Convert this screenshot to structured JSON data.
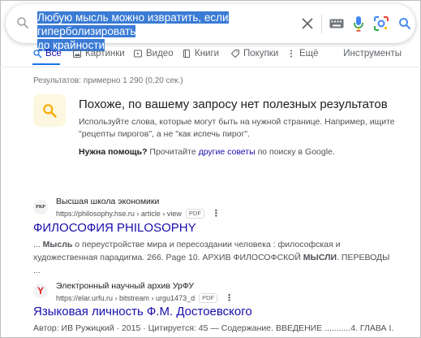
{
  "search": {
    "query_line1": "Любую мысль можно извратить, если гиперболизировать",
    "query_line2": "до крайности"
  },
  "tabs": [
    {
      "label": "Все",
      "icon": "search-icon",
      "active": true
    },
    {
      "label": "Картинки",
      "icon": "image-icon"
    },
    {
      "label": "Видео",
      "icon": "video-icon"
    },
    {
      "label": "Книги",
      "icon": "book-icon"
    },
    {
      "label": "Покупки",
      "icon": "tag-icon"
    },
    {
      "label": "Ещё",
      "icon": "more-vert-icon"
    }
  ],
  "tools_label": "Инструменты",
  "stats": "Результатов: примерно 1 290 (0,20 сек.)",
  "no_results": {
    "title": "Похоже, по вашему запросу нет полезных результатов",
    "text": "Используйте слова, которые могут быть на нужной странице. Например, ищите \"рецепты пирогов\", а не \"как испечь пирог\".",
    "help_bold": "Нужна помощь?",
    "help_pre": " Прочитайте ",
    "help_link": "другие советы",
    "help_post": " по поиску в Google."
  },
  "results": [
    {
      "site": "Высшая школа экономики",
      "favicon_text": "РКР",
      "url": "https://philosophy.hse.ru › article › view",
      "badge": "PDF",
      "title": "ФИЛОСОФИЯ PHILOSOPHY",
      "snippet_pre": "... ",
      "snippet_bold": "Мысль",
      "snippet_post": " о переустройстве мира и пересоздании человека : философская и художественная парадигма. 266. Page 10. АРХИВ ФИЛОСОФСКОЙ ",
      "snippet_bold2": "МЫСЛИ",
      "snippet_end": ". ПЕРЕВОДЫ ..."
    },
    {
      "site": "Электронный научный архив УрФУ",
      "favicon_text": "Y",
      "url": "https://elar.urfu.ru › bitstream › urgu1473_d",
      "badge": "PDF",
      "title": "Языковая личность Ф.М. Достоевского",
      "snippet": "Автор: ИВ Ружицкий · 2015 · Цитируется: 45 — Содержание. ВВЕДЕНИЕ ...........4. ГЛАВА I."
    }
  ],
  "colors": {
    "link": "#1a0dab",
    "accent": "#1a73e8",
    "highlight": "#3a7bd5",
    "warning_bg": "#fef7e0",
    "warning_icon": "#f9ab00"
  }
}
